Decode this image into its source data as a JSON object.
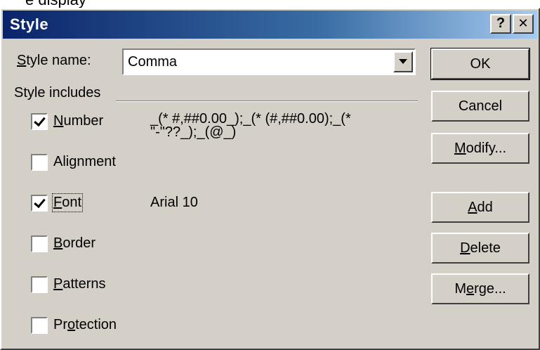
{
  "top_partial_text": "e display",
  "window": {
    "title": "Style",
    "help_label": "?",
    "close_label": "✕",
    "title_gradient": [
      "#0a246a",
      "#a6caf0"
    ],
    "face_color": "#d4d0c8"
  },
  "style_name": {
    "label_prefix": "",
    "label_mnemonic": "S",
    "label_rest": "tyle name:",
    "value": "Comma"
  },
  "includes_heading": "Style includes",
  "options": [
    {
      "pre": "",
      "mn": "N",
      "post": "umber",
      "checked": true,
      "value_line1": "_(* #,##0.00_);_(* (#,##0.00);_(*",
      "value_line2": "\"-\"??_);_(@_)"
    },
    {
      "pre": "Ali",
      "mn": "g",
      "post": "nment",
      "checked": false
    },
    {
      "pre": "",
      "mn": "F",
      "post": "ont",
      "checked": true,
      "value_line1": "Arial 10"
    },
    {
      "pre": "",
      "mn": "B",
      "post": "order",
      "checked": false
    },
    {
      "pre": "",
      "mn": "P",
      "post": "atterns",
      "checked": false
    },
    {
      "pre": "Pr",
      "mn": "o",
      "post": "tection",
      "checked": false
    }
  ],
  "buttons": {
    "ok": "OK",
    "cancel": "Cancel",
    "modify": {
      "pre": "",
      "mn": "M",
      "post": "odify..."
    },
    "add": {
      "pre": "",
      "mn": "A",
      "post": "dd"
    },
    "delete": {
      "pre": "",
      "mn": "D",
      "post": "elete"
    },
    "merge": {
      "pre": "M",
      "mn": "e",
      "post": "rge..."
    }
  }
}
